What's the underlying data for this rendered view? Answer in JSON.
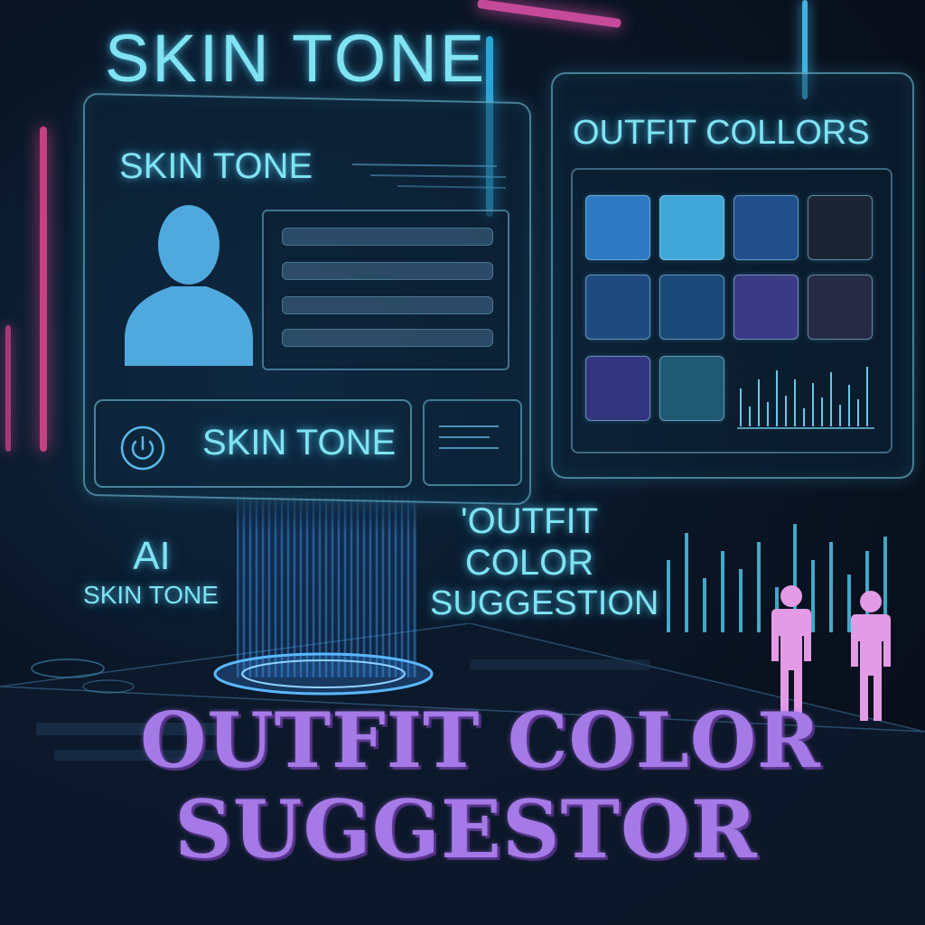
{
  "hero": {
    "title": "SKIN TONE"
  },
  "skin_panel": {
    "heading": "SKIN TONE",
    "footer_label": "SKIN TONE"
  },
  "outfit_panel": {
    "heading": "OUTFIT COLLORS",
    "swatches": [
      "#2d79c4",
      "#3fa8d6",
      "#204f8c",
      "#1b2433",
      "#1f4a80",
      "#1c4a78",
      "#3b3a85",
      "#262a44",
      "#33357e",
      "#1f5a72"
    ]
  },
  "floating": {
    "ai": "AI",
    "ai_sub": "SKIN TONE",
    "suggestion_l1": "'OUTFIT",
    "suggestion_l2": "COLOR",
    "suggestion_l3": "SUGGESTION"
  },
  "main_title": {
    "line1": "OUTFIT COLOR",
    "line2": "SUGGESTOR"
  },
  "colors": {
    "accent_cyan": "#7fe3f2",
    "accent_purple": "#a57ae6",
    "figure_pink": "#e39be6"
  },
  "icons": [
    "person-silhouette-icon",
    "power-icon",
    "human-figure-icon"
  ]
}
